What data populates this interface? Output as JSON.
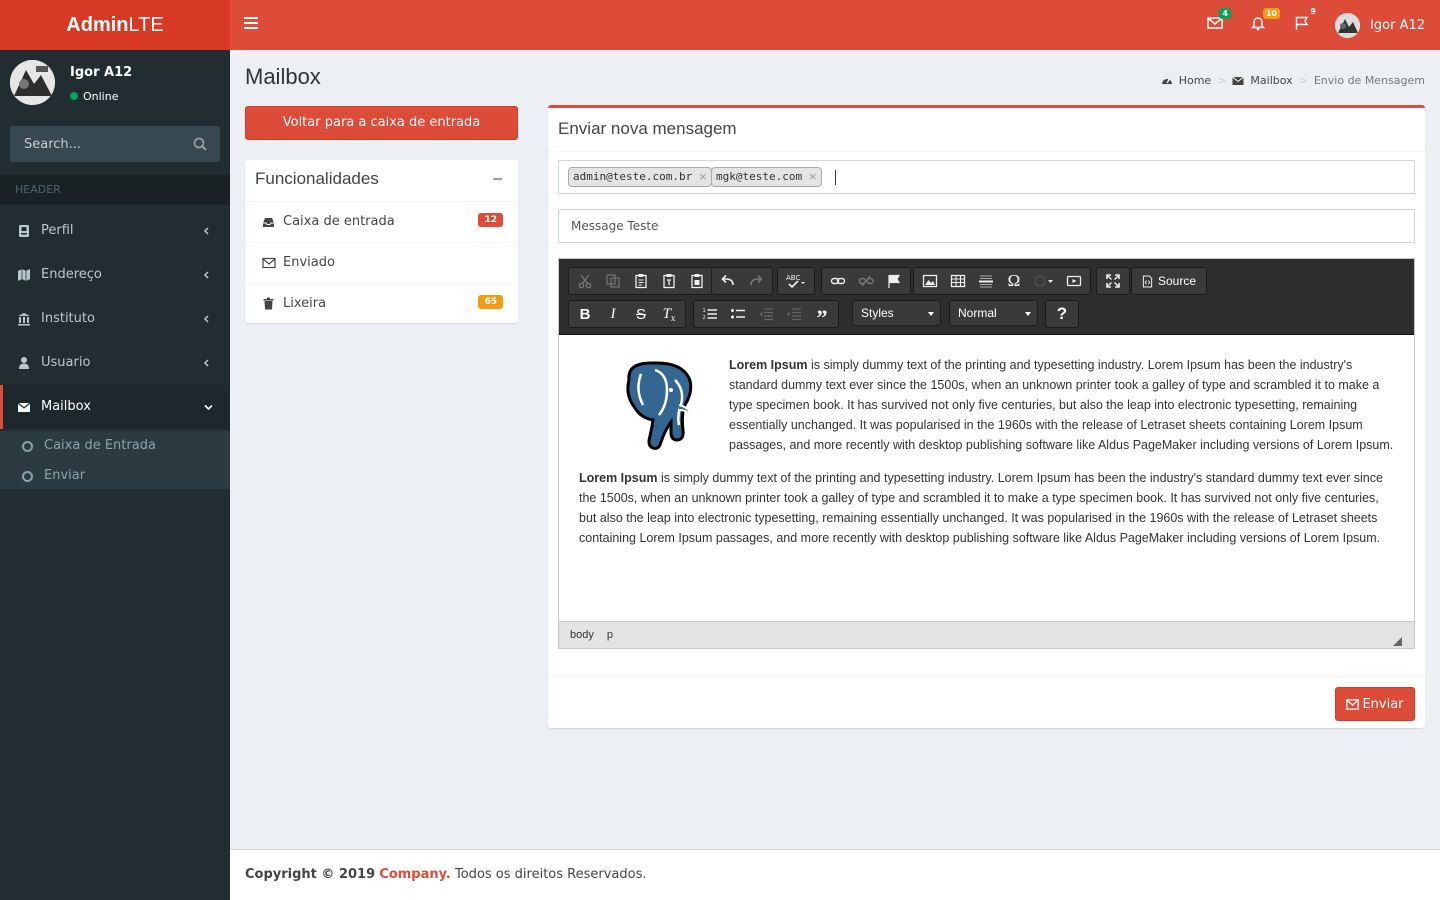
{
  "brand": {
    "bold": "Admin",
    "light": "LTE"
  },
  "header": {
    "messages_count": "4",
    "notifications_count": "10",
    "tasks_count": "9",
    "user_name": "Igor A12",
    "colors": {
      "success": "#00a65a",
      "warning": "#f39c12",
      "danger": "#dd4b39"
    }
  },
  "sidebar": {
    "user_name": "Igor A12",
    "status": "Online",
    "search_placeholder": "Search...",
    "header_label": "HEADER",
    "items": [
      {
        "label": "Perfil",
        "icon": "id-badge-icon"
      },
      {
        "label": "Endereço",
        "icon": "map-icon"
      },
      {
        "label": "Instituto",
        "icon": "institution-icon"
      },
      {
        "label": "Usuario",
        "icon": "user-icon"
      },
      {
        "label": "Mailbox",
        "icon": "envelope-icon"
      }
    ],
    "subitems": [
      {
        "label": "Caixa de Entrada"
      },
      {
        "label": "Enviar"
      }
    ]
  },
  "page": {
    "title": "Mailbox",
    "breadcrumb": [
      "Home",
      "Mailbox",
      "Envio de Mensagem"
    ]
  },
  "back_button": "Voltar para a caixa de entrada",
  "folders": {
    "title": "Funcionalidades",
    "items": [
      {
        "label": "Caixa de entrada",
        "badge": "12"
      },
      {
        "label": "Enviado",
        "badge": ""
      },
      {
        "label": "Lixeira",
        "badge": "65"
      }
    ]
  },
  "compose": {
    "title": "Enviar nova mensagem",
    "recipients": [
      "admin@teste.com.br",
      "mgk@teste.com"
    ],
    "subject": "Message Teste",
    "toolbar": {
      "source_label": "Source",
      "styles_label": "Styles",
      "format_label": "Normal",
      "help_label": "?"
    },
    "body": {
      "p1_bold": "Lorem Ipsum",
      "p1_text": " is simply dummy text of the printing and typesetting industry. Lorem Ipsum has been the industry's standard dummy text ever since the 1500s, when an unknown printer took a galley of type and scrambled it to make a type specimen book. It has survived not only five centuries, but also the leap into electronic typesetting, remaining essentially unchanged. It was popularised in the 1960s with the release of Letraset sheets containing Lorem Ipsum passages, and more recently with desktop publishing software like Aldus PageMaker including versions of Lorem Ipsum.",
      "p2_bold": "Lorem Ipsum",
      "p2_text": " is simply dummy text of the printing and typesetting industry. Lorem Ipsum has been the industry's standard dummy text ever since the 1500s, when an unknown printer took a galley of type and scrambled it to make a type specimen book. It has survived not only five centuries, but also the leap into electronic typesetting, remaining essentially unchanged. It was popularised in the 1960s with the release of Letraset sheets containing Lorem Ipsum passages, and more recently with desktop publishing software like Aldus PageMaker including versions of Lorem Ipsum."
    },
    "path": [
      "body",
      "p"
    ],
    "send_label": "Enviar"
  },
  "footer": {
    "copyright": "Copyright © 2019",
    "company": "Company.",
    "rights": "Todos os direitos Reservados."
  }
}
